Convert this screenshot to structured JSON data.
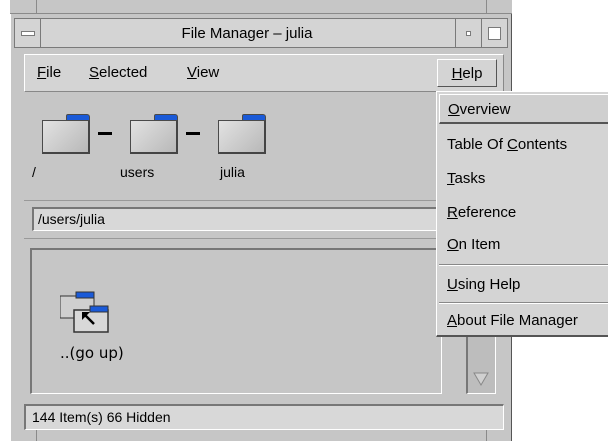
{
  "window": {
    "title": "File Manager – julia"
  },
  "menubar": {
    "file": {
      "accel": "F",
      "rest": "ile"
    },
    "selected": {
      "accel": "S",
      "rest": "elected"
    },
    "view": {
      "accel": "V",
      "rest": "iew"
    },
    "help": {
      "accel": "H",
      "rest": "elp"
    }
  },
  "path_icons": {
    "segments": [
      {
        "label": "/"
      },
      {
        "label": "users"
      },
      {
        "label": "julia"
      }
    ]
  },
  "path_field": {
    "value": "/users/julia"
  },
  "file_list": {
    "items": [
      {
        "label": "..(go up)",
        "icon": "folder-up-icon"
      }
    ]
  },
  "status": {
    "text": "144 Item(s) 66 Hidden"
  },
  "help_menu": {
    "items": [
      {
        "pre": "",
        "accel": "O",
        "rest": "verview",
        "selected": true
      },
      {
        "pre": "Table Of ",
        "accel": "C",
        "rest": "ontents"
      },
      {
        "pre": "",
        "accel": "T",
        "rest": "asks"
      },
      {
        "pre": "",
        "accel": "R",
        "rest": "eference"
      },
      {
        "pre": "",
        "accel": "O",
        "rest": "n Item"
      },
      {
        "pre": "",
        "accel": "U",
        "rest": "sing Help"
      },
      {
        "pre": "",
        "accel": "A",
        "rest": "bout File Manager"
      }
    ]
  },
  "colors": {
    "frame": "#c6c6c6",
    "folder_tab": "#1a5ad8",
    "folder_body": "#d0d0d0"
  }
}
